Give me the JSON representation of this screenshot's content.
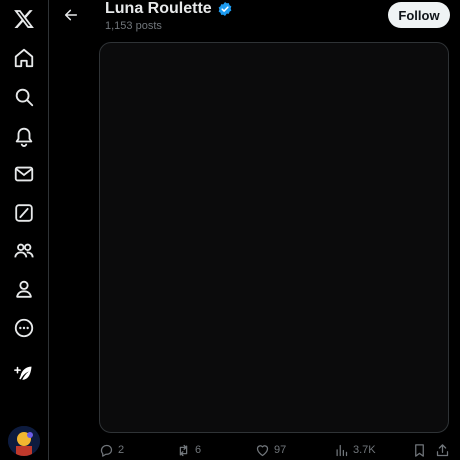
{
  "sidebar": {
    "items": [
      {
        "icon": "x-logo-icon"
      },
      {
        "icon": "home-icon"
      },
      {
        "icon": "search-icon"
      },
      {
        "icon": "notifications-bell-icon"
      },
      {
        "icon": "messages-envelope-icon"
      },
      {
        "icon": "grok-icon"
      },
      {
        "icon": "communities-icon"
      },
      {
        "icon": "profile-icon"
      },
      {
        "icon": "more-circle-icon"
      }
    ],
    "compose_icon": "compose-feather-icon",
    "avatar": "account-avatar"
  },
  "header": {
    "back_icon": "back-arrow-icon",
    "name": "Luna Roulette",
    "post_count": "1,153 posts",
    "follow_label": "Follow"
  },
  "media": {
    "omitted": true
  },
  "actions": {
    "reply_count": "2",
    "repost_count": "6",
    "like_count": "97",
    "views_count": "3.7K"
  },
  "colors": {
    "background": "#000000",
    "accent": "#1d9bf0",
    "muted_text": "#71767b",
    "follow_bg": "#eff3f4"
  }
}
